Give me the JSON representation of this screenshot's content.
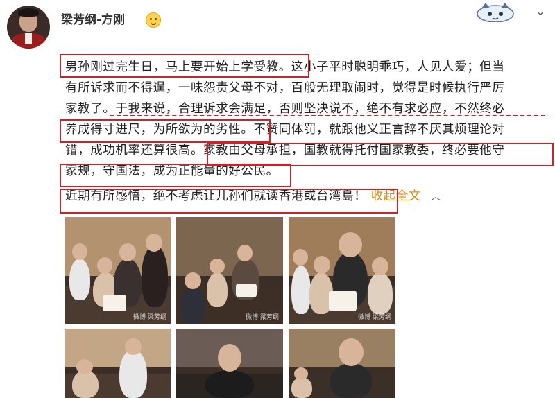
{
  "header": {
    "username": "梁芳纲-方刚",
    "badge_icon": "smile-emoji-badge-icon",
    "sticker_icon": "cartoon-sticker-icon",
    "menu_icon": "chevron-down-icon"
  },
  "post": {
    "lines": [
      "男孙刚过完生日，马上要开始上学受教。这小子平时聪明乖巧，人见人爱；但当",
      "有所诉求而不得逞，一味怨责父母不对，百般无理取闹时，觉得是时候执行严厉",
      "家教了。于我来说，合理诉求会满足，否则坚决说不，绝不有求必应，不然终必",
      "养成得寸进尺，为所欲为的劣性。不赞同体罚，就跟他义正言辞不厌其烦理论对",
      "错，成功机率还算很高。家教由父母承担，国教就得托付国家教委，终必要他守",
      "家规，守国法，成为正能量的好公民。"
    ],
    "last_line": "近期有所感悟，绝不考虑让儿孙们就读香港或台湾島！",
    "collapse_label": "收起全文",
    "collapse_icon": "chevron-up-icon"
  },
  "colors": {
    "highlight": "#c9242d",
    "collapse": "#e08a17"
  },
  "photos": {
    "watermark": "微博 梁芳纲"
  }
}
